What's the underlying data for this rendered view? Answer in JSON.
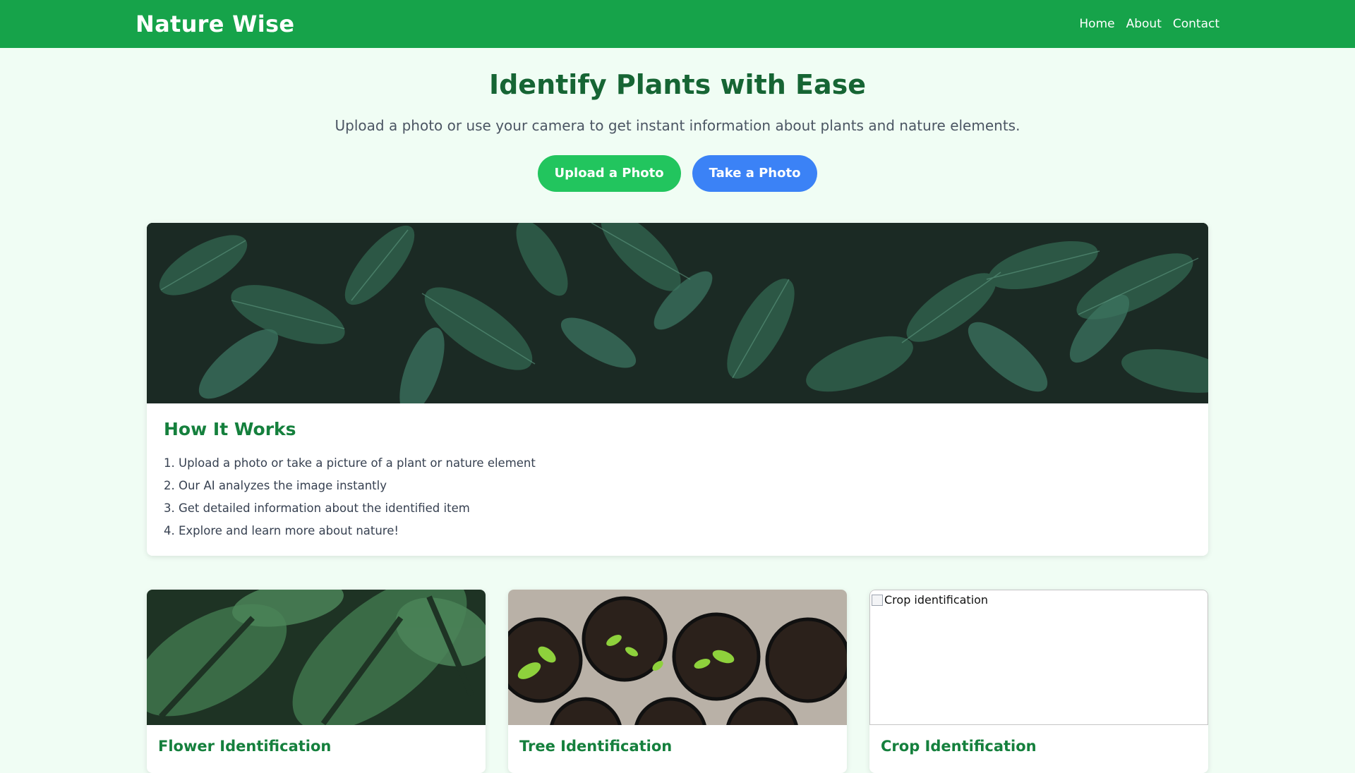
{
  "navbar": {
    "brand": "Nature Wise",
    "links": [
      {
        "label": "Home"
      },
      {
        "label": "About"
      },
      {
        "label": "Contact"
      }
    ]
  },
  "hero": {
    "title": "Identify Plants with Ease",
    "subtitle": "Upload a photo or use your camera to get instant information about plants and nature elements.",
    "upload_label": "Upload a Photo",
    "camera_label": "Take a Photo"
  },
  "how_it_works": {
    "title": "How It Works",
    "steps": [
      "1. Upload a photo or take a picture of a plant or nature element",
      "2. Our AI analyzes the image instantly",
      "3. Get detailed information about the identified item",
      "4. Explore and learn more about nature!"
    ]
  },
  "features": [
    {
      "title": "Flower Identification",
      "image": "leaves-photo"
    },
    {
      "title": "Tree Identification",
      "image": "seedlings-photo"
    },
    {
      "title": "Crop Identification",
      "image_alt": "Crop identification"
    }
  ],
  "colors": {
    "primary": "#16a34a",
    "upload_button": "#22c55e",
    "camera_button": "#3b82f6",
    "heading": "#166534",
    "background": "#f0fdf4"
  }
}
